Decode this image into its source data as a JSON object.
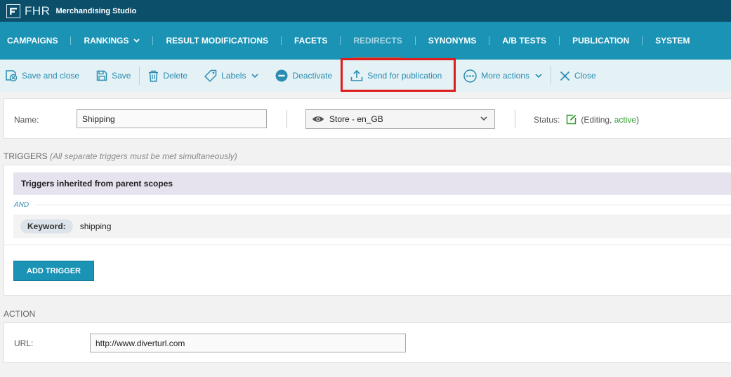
{
  "app": {
    "logo_text": "FHR",
    "name": "Merchandising Studio"
  },
  "nav": {
    "items": [
      {
        "label": "CAMPAIGNS"
      },
      {
        "label": "RANKINGS"
      },
      {
        "label": "RESULT MODIFICATIONS"
      },
      {
        "label": "FACETS"
      },
      {
        "label": "REDIRECTS"
      },
      {
        "label": "SYNONYMS"
      },
      {
        "label": "A/B TESTS"
      },
      {
        "label": "PUBLICATION"
      },
      {
        "label": "SYSTEM"
      }
    ],
    "active": "REDIRECTS"
  },
  "toolbar": {
    "save_close": "Save and close",
    "save": "Save",
    "delete": "Delete",
    "labels": "Labels",
    "deactivate": "Deactivate",
    "send_for_publication": "Send for publication",
    "more_actions": "More actions",
    "close": "Close"
  },
  "form": {
    "name_label": "Name:",
    "name_value": "Shipping",
    "scope_value": "Store - en_GB",
    "status_label": "Status:",
    "status_open": "(Editing, ",
    "status_active": "active",
    "status_close": ")"
  },
  "triggers": {
    "title": "TRIGGERS",
    "note": "(All separate triggers must be met simultaneously)",
    "inherited": "Triggers inherited from parent scopes",
    "and": "AND",
    "keyword_label": "Keyword:",
    "keyword_value": "shipping",
    "add_button": "ADD TRIGGER"
  },
  "action": {
    "title": "ACTION",
    "url_label": "URL:",
    "url_value": "http://www.diverturl.com"
  },
  "colors": {
    "topbar": "#0b4f6b",
    "nav": "#1a93b5",
    "toolbar": "#e4f1f5",
    "link": "#2a8db1",
    "active_underline": "#e8553a",
    "highlight": "#e01b1b",
    "status_green": "#2f9a2f"
  }
}
